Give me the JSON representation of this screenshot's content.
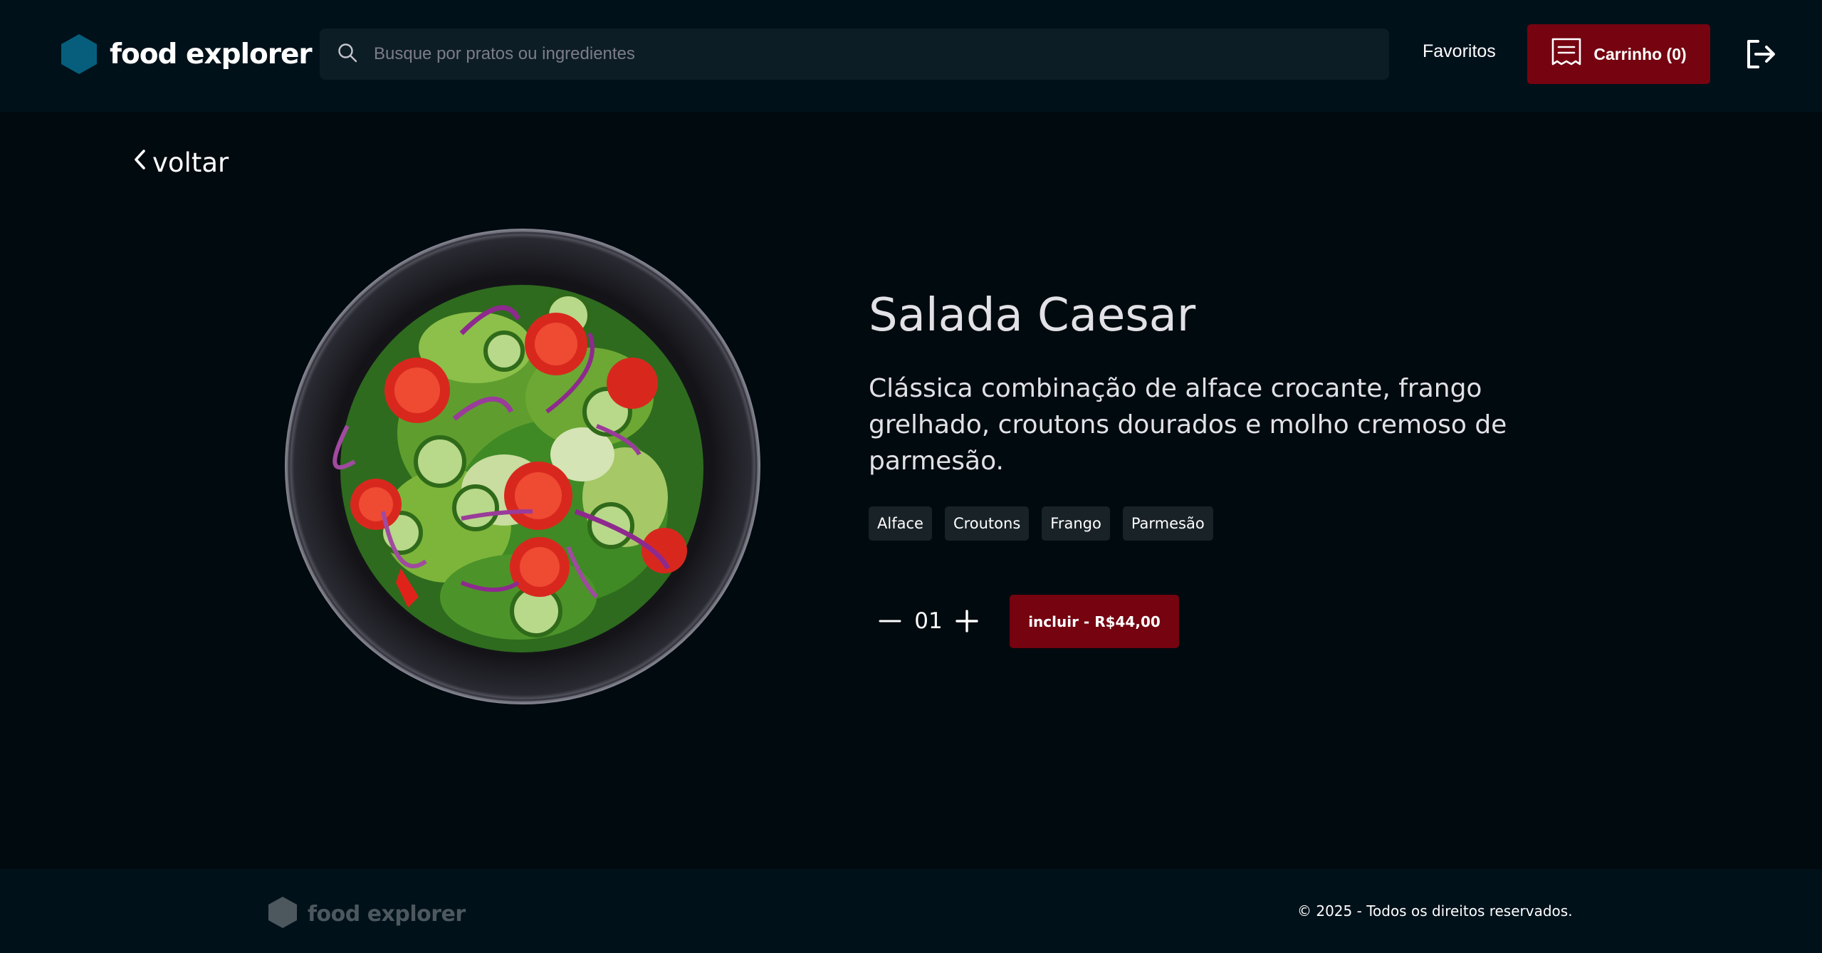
{
  "header": {
    "brand_name": "food explorer",
    "search_placeholder": "Busque por pratos ou ingredientes",
    "favorites_label": "Favoritos",
    "cart_label": "Carrinho (0)"
  },
  "back_label": "voltar",
  "dish": {
    "title": "Salada Caesar",
    "description": "Clássica combinação de alface crocante, frango grelhado, croutons dourados e molho cremoso de parmesão.",
    "ingredients": [
      "Alface",
      "Croutons",
      "Frango",
      "Parmesão"
    ],
    "quantity": "01",
    "include_label": "incluir - R$44,00"
  },
  "footer": {
    "brand_name": "food explorer",
    "copyright": "© 2025 - Todos os direitos reservados."
  },
  "colors": {
    "background": "#000A0F",
    "header_bg": "#00111A",
    "accent": "#750310",
    "brand_logo": "#065E7C",
    "footer_logo": "#4D585E",
    "tag_bg": "#192227"
  },
  "icons": {
    "brand_logo": "hexagon-icon",
    "search": "search-icon",
    "cart": "receipt-icon",
    "logout": "sign-out-icon",
    "back": "chevron-left-icon",
    "decrement": "minus-icon",
    "increment": "plus-icon"
  }
}
